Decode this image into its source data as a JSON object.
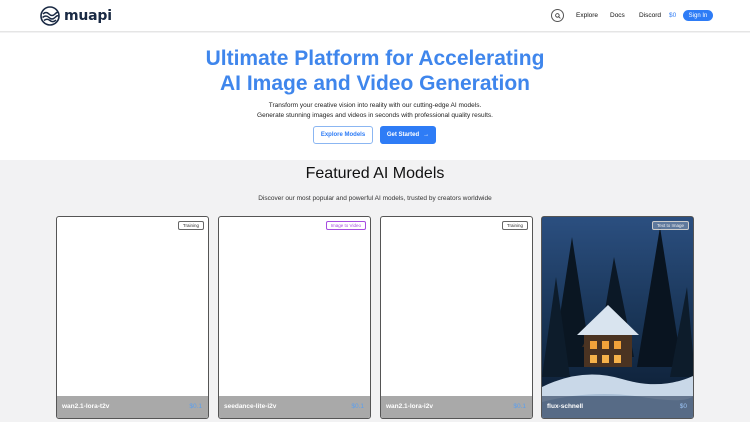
{
  "nav": {
    "brand": "muapi",
    "links": [
      "Explore",
      "Docs",
      "Discord"
    ],
    "price": "$0",
    "signin": "Sign In"
  },
  "hero": {
    "title_line1": "Ultimate Platform for Accelerating",
    "title_line2": "AI Image and Video Generation",
    "subtitle_line1": "Transform your creative vision into reality with our cutting-edge AI models.",
    "subtitle_line2": "Generate stunning images and videos in seconds with professional quality results.",
    "explore_label": "Explore Models",
    "start_label": "Get Started",
    "start_arrow": "→"
  },
  "featured": {
    "title": "Featured AI Models",
    "subtitle": "Discover our most popular and powerful AI models, trusted by creators worldwide",
    "cards": [
      {
        "badge": "Training",
        "name": "wan2.1-lora-t2v",
        "price": "$0.1"
      },
      {
        "badge": "Image to Video",
        "name": "seedance-lite-i2v",
        "price": "$0.1"
      },
      {
        "badge": "Training",
        "name": "wan2.1-lora-i2v",
        "price": "$0.1"
      },
      {
        "badge": "Text to Image",
        "name": "flux-schnell",
        "price": "$0"
      }
    ]
  },
  "colors": {
    "accent": "#2e7cf6",
    "title_blue": "#3f86ec",
    "badge_purple": "#a64ce0"
  }
}
